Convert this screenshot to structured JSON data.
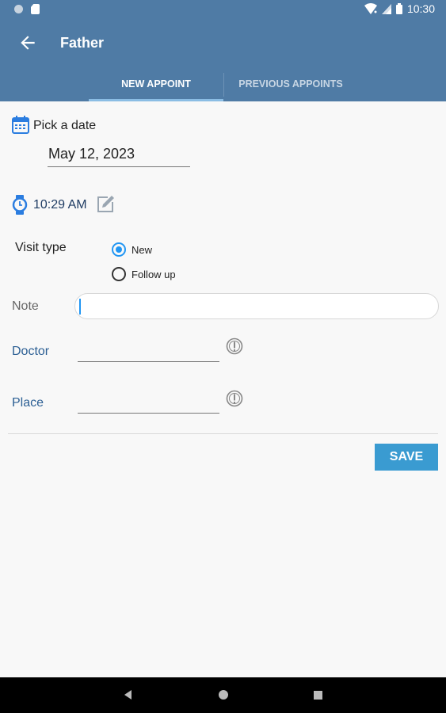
{
  "status_bar": {
    "time": "10:30"
  },
  "app_bar": {
    "title": "Father"
  },
  "tabs": [
    {
      "label": "NEW APPOINT"
    },
    {
      "label": "PREVIOUS APPOINTS"
    }
  ],
  "date": {
    "label": "Pick a date",
    "value": "May 12, 2023"
  },
  "time": {
    "value": "10:29 AM"
  },
  "visit_type": {
    "label": "Visit type",
    "options": [
      {
        "label": "New",
        "selected": true
      },
      {
        "label": "Follow up",
        "selected": false
      }
    ]
  },
  "note": {
    "label": "Note",
    "value": ""
  },
  "doctor": {
    "label": "Doctor",
    "value": ""
  },
  "place": {
    "label": "Place",
    "value": ""
  },
  "save_label": "SAVE",
  "colors": {
    "app_bar": "#4f7ba5",
    "accent": "#2196f3",
    "save_button": "#3a9bd1"
  }
}
